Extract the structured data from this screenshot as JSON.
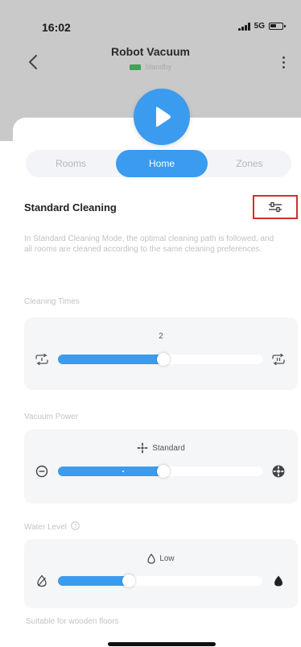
{
  "status_bar": {
    "time": "16:02",
    "network": "5G"
  },
  "header": {
    "title": "Robot Vacuum",
    "device_status": "Standby"
  },
  "play_button": {
    "icon": "play-icon"
  },
  "mode_tabs": {
    "items": [
      {
        "label": "Rooms",
        "selected": false
      },
      {
        "label": "Home",
        "selected": true
      },
      {
        "label": "Zones",
        "selected": false
      }
    ]
  },
  "cleaning_mode": {
    "title": "Standard Cleaning",
    "settings_icon": "sliders-icon",
    "description": "In Standard Cleaning Mode, the optimal cleaning path is followed, and all rooms are cleaned according to the same cleaning preferences."
  },
  "cleaning_times": {
    "label": "Cleaning Times",
    "value": "2",
    "level_fraction": 0.5,
    "left_icon": "repeat-once-icon",
    "right_icon": "repeat-twice-icon"
  },
  "vacuum_power": {
    "label": "Vacuum Power",
    "value": "Standard",
    "level_fraction": 0.5,
    "value_icon": "fan-icon",
    "left_icon": "quiet-icon",
    "right_icon": "max-power-icon"
  },
  "water_level": {
    "label": "Water Level",
    "value": "Low",
    "level_fraction": 0.33,
    "value_icon": "drop-outline-icon",
    "left_icon": "no-water-icon",
    "right_icon": "drop-filled-icon",
    "note": "Suitable for wooden floors"
  },
  "colors": {
    "accent": "#3b9bef",
    "highlight_box": "#d32f2f",
    "header_bg": "#c9c9c9",
    "battery_green": "#3aa55a"
  }
}
